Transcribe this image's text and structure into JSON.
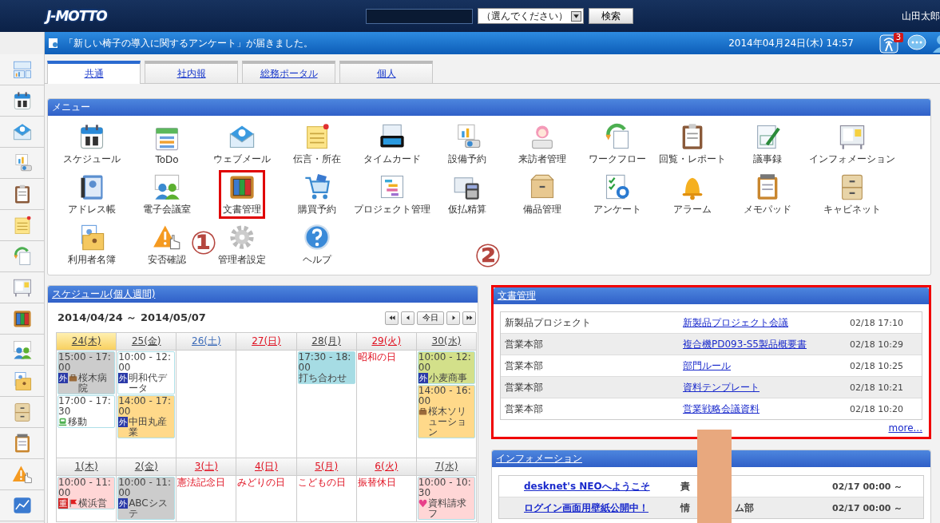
{
  "header": {
    "logo": "J-MOTTO",
    "search": {
      "scope": "（選んでください）",
      "button": "検索"
    },
    "user": "山田太郎"
  },
  "notice_bar": {
    "message": "「新しい椅子の導入に関するアンケート」が届きました。",
    "datetime": "2014年04月24日(木) 14:57",
    "notification_count": "3"
  },
  "tabs": [
    {
      "label": "共通",
      "selected": true
    },
    {
      "label": "社内報",
      "selected": false
    },
    {
      "label": "総務ポータル",
      "selected": false
    },
    {
      "label": "個人",
      "selected": false
    }
  ],
  "menu": {
    "title": "メニュー",
    "items": [
      {
        "label": "スケジュール",
        "highlighted": false
      },
      {
        "label": "ToDo",
        "highlighted": false
      },
      {
        "label": "ウェブメール",
        "highlighted": false
      },
      {
        "label": "伝言・所在",
        "highlighted": false
      },
      {
        "label": "タイムカード",
        "highlighted": false
      },
      {
        "label": "設備予約",
        "highlighted": false
      },
      {
        "label": "来訪者管理",
        "highlighted": false
      },
      {
        "label": "ワークフロー",
        "highlighted": false
      },
      {
        "label": "回覧・レポート",
        "highlighted": false
      },
      {
        "label": "議事録",
        "highlighted": false
      },
      {
        "label": "インフォメーション",
        "highlighted": false
      },
      {
        "label": "アドレス帳",
        "highlighted": false
      },
      {
        "label": "電子会議室",
        "highlighted": false
      },
      {
        "label": "文書管理",
        "highlighted": true
      },
      {
        "label": "購買予約",
        "highlighted": false
      },
      {
        "label": "プロジェクト管理",
        "highlighted": false
      },
      {
        "label": "仮払精算",
        "highlighted": false
      },
      {
        "label": "備品管理",
        "highlighted": false
      },
      {
        "label": "アンケート",
        "highlighted": false
      },
      {
        "label": "アラーム",
        "highlighted": false
      },
      {
        "label": "メモパッド",
        "highlighted": false
      },
      {
        "label": "キャビネット",
        "highlighted": false
      },
      {
        "label": "利用者名簿",
        "highlighted": false
      },
      {
        "label": "安否確認",
        "highlighted": false
      },
      {
        "label": "管理者設定",
        "highlighted": false
      },
      {
        "label": "ヘルプ",
        "highlighted": false
      }
    ]
  },
  "annotations": [
    "①",
    "②"
  ],
  "schedule": {
    "title": "スケジュール(個人週間)",
    "range": "2014/04/24 ～ 2014/05/07",
    "today_button": "今日",
    "weeks": [
      {
        "days": [
          {
            "label": "24(木)",
            "kind": "weekday",
            "today": true,
            "events": [
              {
                "time": "15:00 - 17:00",
                "badge": {
                  "text": "外",
                  "color": "#2b3aa8"
                },
                "kind": "bag",
                "title": "桜木病院",
                "color": "#cccccc"
              },
              {
                "time": "17:00 - 17:30",
                "kind": "train",
                "title": "移動",
                "color": "#ffffff"
              }
            ]
          },
          {
            "label": "25(金)",
            "kind": "weekday",
            "today": false,
            "events": [
              {
                "time": "10:00 - 12:00",
                "badge": {
                  "text": "外",
                  "color": "#2b3aa8"
                },
                "title": "明和代データ",
                "color": "#ffffff"
              },
              {
                "time": "14:00 - 17:00",
                "badge": {
                  "text": "外",
                  "color": "#2b3aa8"
                },
                "title": "中田丸産業",
                "color": "#ffd98a"
              }
            ]
          },
          {
            "label": "26(土)",
            "kind": "saturday",
            "today": false
          },
          {
            "label": "27(日)",
            "kind": "holiday",
            "today": false
          },
          {
            "label": "28(月)",
            "kind": "weekday",
            "today": false,
            "events": [
              {
                "time": "17:30 - 18:00",
                "title": "打ち合わせ",
                "color": "#a6dce4"
              }
            ]
          },
          {
            "label": "29(火)",
            "kind": "holiday",
            "today": false,
            "holiday": "昭和の日"
          },
          {
            "label": "30(水)",
            "kind": "weekday",
            "today": false,
            "events": [
              {
                "time": "10:00 - 12:00",
                "badge": {
                  "text": "外",
                  "color": "#2b3aa8"
                },
                "title": "小麦商事",
                "color": "#d3e08a"
              },
              {
                "time": "14:00 - 16:00",
                "kind": "bag",
                "title": "桜木ソリューション",
                "color": "#ffd98a"
              }
            ]
          }
        ]
      },
      {
        "days": [
          {
            "label": "1(木)",
            "kind": "weekday",
            "today": false,
            "events": [
              {
                "time": "10:00 - 11:00",
                "badge": {
                  "text": "重",
                  "color": "#d42a2a"
                },
                "kind": "flag",
                "title": "横浜営",
                "color": "#ffd6d6"
              }
            ]
          },
          {
            "label": "2(金)",
            "kind": "weekday",
            "today": false,
            "events": [
              {
                "time": "10:00 - 11:00",
                "badge": {
                  "text": "外",
                  "color": "#2b3aa8"
                },
                "title": "ABCシステ",
                "color": "#cccccc"
              }
            ]
          },
          {
            "label": "3(土)",
            "kind": "holiday",
            "today": false,
            "holiday": "憲法記念日"
          },
          {
            "label": "4(日)",
            "kind": "holiday",
            "today": false,
            "holiday": "みどりの日"
          },
          {
            "label": "5(月)",
            "kind": "holiday",
            "today": false,
            "holiday": "こどもの日"
          },
          {
            "label": "6(火)",
            "kind": "holiday",
            "today": false,
            "holiday": "振替休日"
          },
          {
            "label": "7(水)",
            "kind": "weekday",
            "today": false,
            "events": [
              {
                "time": "10:00 - 10:30",
                "kind": "heart",
                "title": "資料請求フ",
                "color": "#ffd6d6"
              }
            ]
          }
        ]
      }
    ]
  },
  "documents": {
    "title": "文書管理",
    "highlighted": true,
    "rows": [
      {
        "folder": "新製品プロジェクト",
        "title": "新製品プロジェクト会議",
        "date": "02/18 17:10"
      },
      {
        "folder": "営業本部",
        "title": "複合機PD093-S5製品概要書",
        "date": "02/18 10:29"
      },
      {
        "folder": "営業本部",
        "title": "部門ルール",
        "date": "02/18 10:25"
      },
      {
        "folder": "営業本部",
        "title": "資料テンプレート",
        "date": "02/18 10:21"
      },
      {
        "folder": "営業本部",
        "title": "営業戦略会議資料",
        "date": "02/18 10:20"
      }
    ],
    "more": "more..."
  },
  "information": {
    "title": "インフォメーション",
    "rows": [
      {
        "title": "desknet's NEOへようこそ",
        "author_parts": [
          "責"
        ],
        "date": "02/17 00:00 ～"
      },
      {
        "title": "ログイン画面用壁紙公開中！",
        "author_parts": [
          "情",
          "ム部"
        ],
        "date": "02/17 00:00 ～"
      }
    ]
  }
}
